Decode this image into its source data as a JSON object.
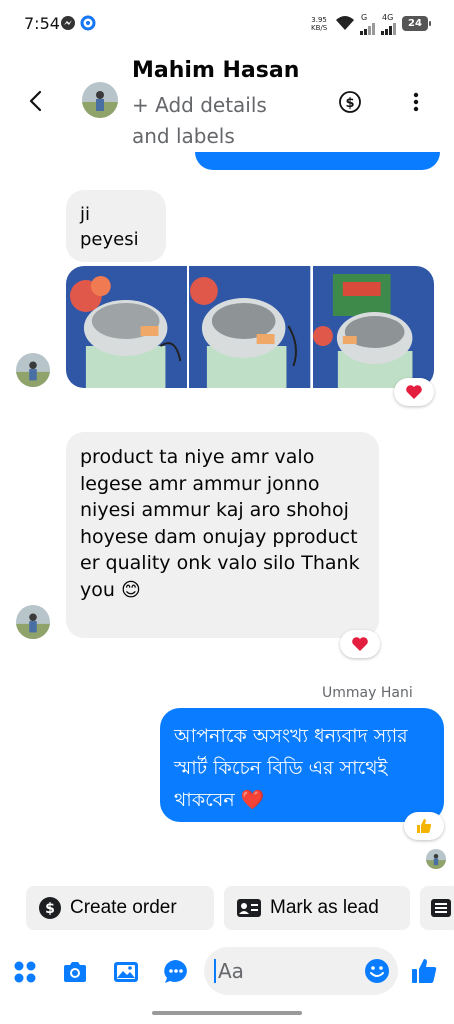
{
  "status_bar": {
    "time": "7:54",
    "net_speed_value": "3.95",
    "net_speed_unit": "KB/S",
    "signal_1_label": "G",
    "signal_2_label": "4G",
    "battery": "24"
  },
  "header": {
    "contact_name": "Mahim Hasan",
    "add_details": "+ Add details and labels"
  },
  "messages": [
    {
      "direction": "incoming",
      "text": "ji\npeyesi"
    },
    {
      "direction": "incoming",
      "type": "photos",
      "count": 3,
      "reaction": "heart"
    },
    {
      "direction": "incoming",
      "text": "product ta niye amr valo legese amr ammur jonno niyesi ammur kaj aro shohoj hoyese dam onujay pproduct er quality onk valo silo Thank you 😊",
      "reaction": "heart"
    },
    {
      "direction": "outgoing",
      "sender": "Ummay Hani",
      "text": "আপনাকে অসংখ্য ধন্যবাদ স্যার স্মার্ট কিচেন বিডি  এর সাথেই থাকবেন ❤️",
      "reaction": "thumbs-up"
    }
  ],
  "quick_actions": {
    "create_order": "Create order",
    "mark_as_lead": "Mark as lead"
  },
  "composer": {
    "placeholder": "Aa"
  },
  "colors": {
    "accent": "#0a7cff",
    "incoming_bubble": "#f0f0f0",
    "reaction_heart": "#e41e3f"
  }
}
